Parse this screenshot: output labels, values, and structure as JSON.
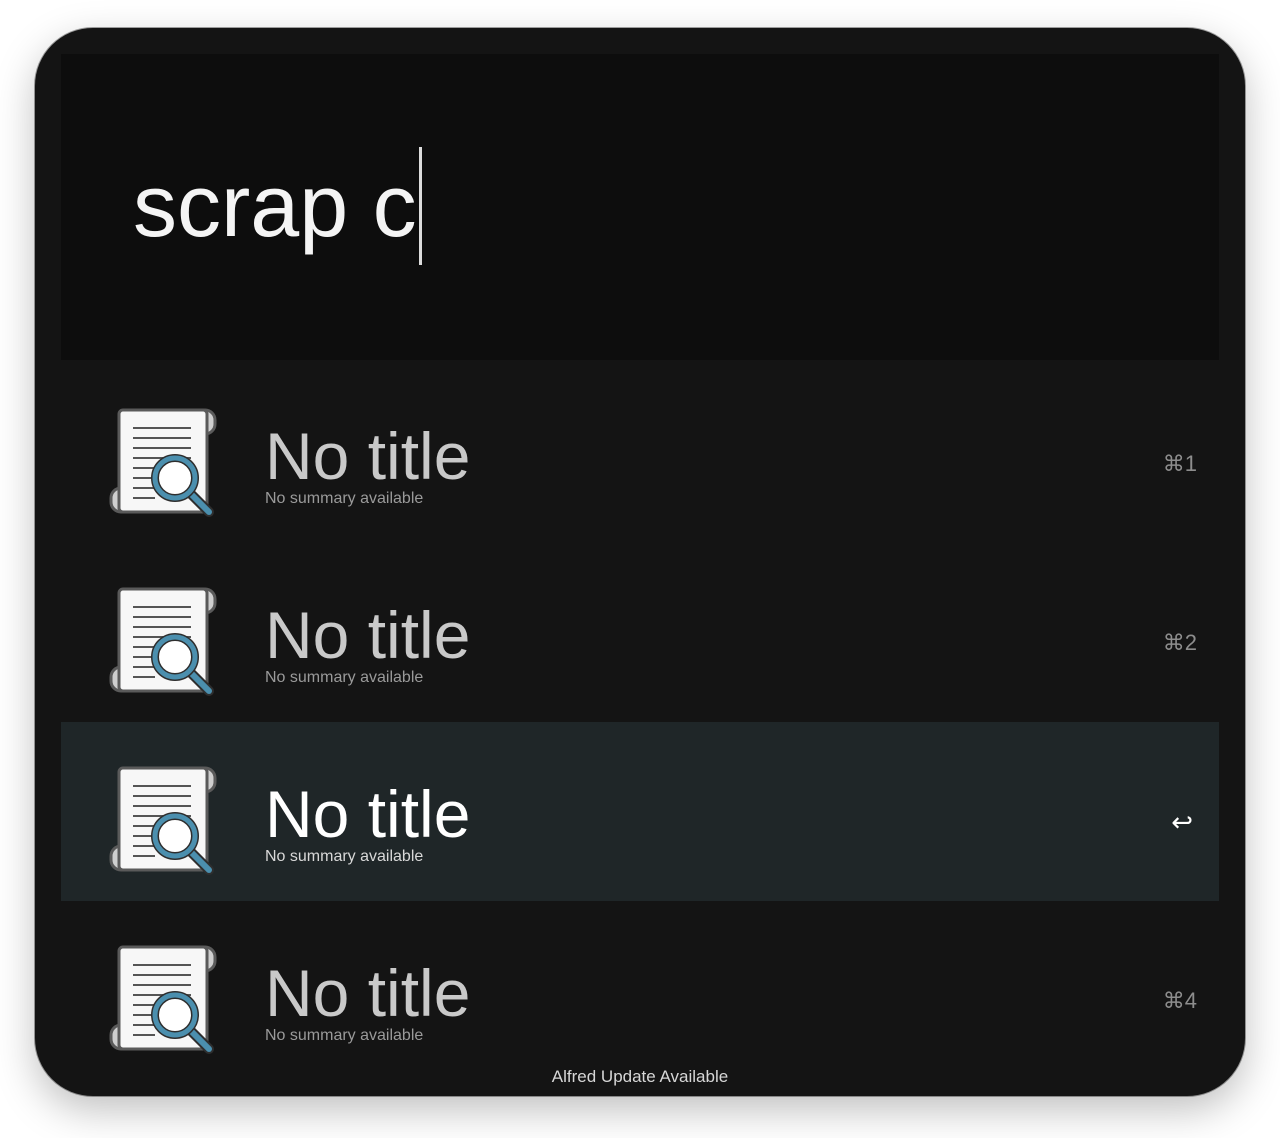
{
  "search": {
    "query": "scrap c"
  },
  "results": [
    {
      "title": "No title",
      "subtitle": "No summary available",
      "shortcut": "⌘1",
      "selected": false,
      "icon": "document-search-icon"
    },
    {
      "title": "No title",
      "subtitle": "No summary available",
      "shortcut": "⌘2",
      "selected": false,
      "icon": "document-search-icon"
    },
    {
      "title": "No title",
      "subtitle": "No summary available",
      "shortcut": "↩",
      "selected": true,
      "icon": "document-search-icon"
    },
    {
      "title": "No title",
      "subtitle": "No summary available",
      "shortcut": "⌘4",
      "selected": false,
      "icon": "document-search-icon"
    }
  ],
  "footer": {
    "update_notice": "Alfred Update Available"
  },
  "colors": {
    "background": "#141414",
    "search_area": "#0d0d0d",
    "selected_row": "#1f2628",
    "magnifier_accent": "#4b8fae"
  }
}
